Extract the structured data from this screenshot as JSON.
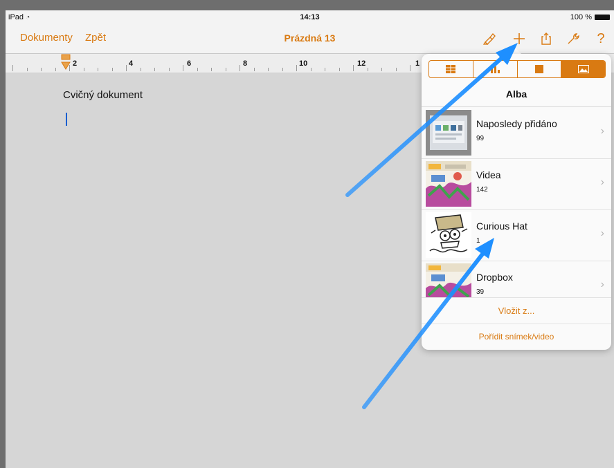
{
  "status_bar": {
    "device": "iPad",
    "wifi_icon": "wifi-icon",
    "time": "14:13",
    "battery": "100 %"
  },
  "toolbar": {
    "documents_label": "Dokumenty",
    "back_label": "Zpět",
    "title": "Prázdná 13",
    "icons": [
      "brush-icon",
      "plus-icon",
      "share-icon",
      "wrench-icon",
      "help-icon"
    ],
    "help_glyph": "?"
  },
  "ruler": {
    "labels": [
      "2",
      "4",
      "6",
      "8",
      "10",
      "12",
      "1"
    ]
  },
  "document": {
    "title": "Cvičný dokument"
  },
  "popover": {
    "segments": [
      "table-icon",
      "chart-icon",
      "shape-icon",
      "media-icon"
    ],
    "active_segment": "media-icon",
    "header": "Alba",
    "albums": [
      {
        "name": "Naposledy přidáno",
        "count": "99"
      },
      {
        "name": "Videa",
        "count": "142"
      },
      {
        "name": "Curious Hat",
        "count": "1"
      },
      {
        "name": "Dropbox",
        "count": "39"
      }
    ],
    "insert_from": "Vložit z...",
    "take_photo": "Pořídit snímek/video"
  },
  "colors": {
    "accent": "#d97a12",
    "annotation_arrow": "#1e8fff"
  }
}
